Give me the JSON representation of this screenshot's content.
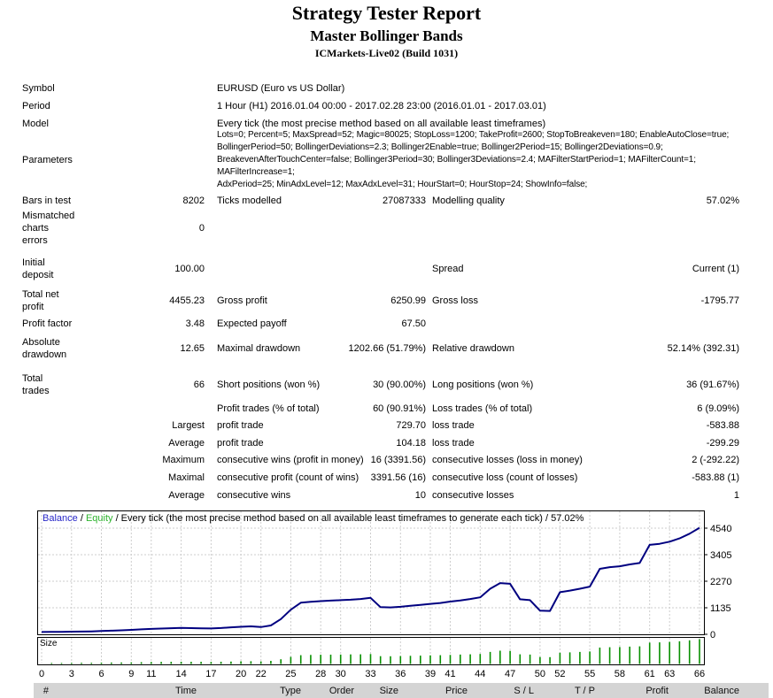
{
  "page": {
    "title": "Strategy Tester Report",
    "subtitle": "Master Bollinger Bands",
    "server": "ICMarkets-Live02 (Build 1031)"
  },
  "summary_rows": [
    {
      "c1": "Symbol",
      "c3": "EURUSD (Euro vs US Dollar)"
    },
    {
      "c1": "Period",
      "c3": "1 Hour (H1) 2016.01.04 00:00 - 2017.02.28 23:00 (2016.01.01 - 2017.03.01)"
    },
    {
      "c1": "Model",
      "c3": "Every tick (the most precise method based on all available least timeframes)"
    },
    {
      "c1": "Parameters",
      "c3": "Lots=0; Percent=5; MaxSpread=52; Magic=80025; StopLoss=1200; TakeProfit=2600; StopToBreakeven=180; EnableAutoClose=true;\nBollingerPeriod=50; BollingerDeviations=2.3; Bollinger2Enable=true; Bollinger2Period=15; Bollinger2Deviations=0.9;\nBreakevenAfterTouchCenter=false; Bollinger3Period=30; Bollinger3Deviations=2.4; MAFilterStartPeriod=1; MAFilterCount=1; MAFilterIncrease=1;\nAdxPeriod=25; MinAdxLevel=12; MaxAdxLevel=31; HourStart=0; HourStop=24; ShowInfo=false;",
      "params_style": true
    },
    {
      "c1": "Bars in test",
      "c2": "8202",
      "c3": "Ticks modelled",
      "c4": "27087333",
      "c5": "Modelling quality",
      "c6": "57.02%"
    },
    {
      "c1": "Mismatched\ncharts\nerrors",
      "c2": "0"
    },
    {
      "c1": "Initial\ndeposit",
      "c2": "100.00",
      "c5": "Spread",
      "c6": "Current (1)"
    },
    {
      "c1": "Total net\nprofit",
      "c2": "4455.23",
      "c3": "Gross profit",
      "c4": "6250.99",
      "c5": "Gross loss",
      "c6": "-1795.77"
    },
    {
      "c1": "Profit factor",
      "c2": "3.48",
      "c3": "Expected payoff",
      "c4": "67.50"
    },
    {
      "c1": "Absolute\ndrawdown",
      "c2": "12.65",
      "c3": "Maximal drawdown",
      "c4": "1202.66 (51.79%)",
      "c5": "Relative drawdown",
      "c6": "52.14% (392.31)"
    },
    {
      "c1": "Total\ntrades",
      "c2": "66",
      "c3": "Short positions (won %)",
      "c4": "30 (90.00%)",
      "c5": "Long positions (won %)",
      "c6": "36 (91.67%)"
    },
    {
      "c3": "Profit trades (% of total)",
      "c4": "60 (90.91%)",
      "c5": "Loss trades (% of total)",
      "c6": "6 (9.09%)"
    },
    {
      "c2": "Largest",
      "c3": "profit trade",
      "c4": "729.70",
      "c5": "loss trade",
      "c6": "-583.88"
    },
    {
      "c2": "Average",
      "c3": "profit trade",
      "c4": "104.18",
      "c5": "loss trade",
      "c6": "-299.29"
    },
    {
      "c2": "Maximum",
      "c3": "consecutive wins (profit in money)",
      "c4": "16 (3391.56)",
      "c5": "consecutive losses (loss in money)",
      "c6": "2 (-292.22)"
    },
    {
      "c2": "Maximal",
      "c3": "consecutive profit (count of wins)",
      "c4": "3391.56 (16)",
      "c5": "consecutive loss (count of losses)",
      "c6": "-583.88 (1)"
    },
    {
      "c2": "Average",
      "c3": "consecutive wins",
      "c4": "10",
      "c5": "consecutive losses",
      "c6": "1"
    }
  ],
  "chart_data": {
    "type": "line",
    "legend": [
      {
        "text": "Balance",
        "color": "#2828c8"
      },
      {
        "text": " / ",
        "color": "#000000"
      },
      {
        "text": "Equity",
        "color": "#2db32d"
      },
      {
        "text": " / Every tick (the most precise method based on all available least timeframes to generate each tick) / 57.02%",
        "color": "#000000"
      }
    ],
    "x_ticks": [
      0,
      3,
      6,
      9,
      11,
      14,
      17,
      20,
      22,
      25,
      28,
      30,
      33,
      36,
      39,
      41,
      44,
      47,
      50,
      52,
      55,
      58,
      61,
      63,
      66
    ],
    "y_ticks": [
      0,
      1135,
      2270,
      3405,
      4540
    ],
    "xlim": [
      0,
      66
    ],
    "ylim": [
      0,
      5295
    ],
    "grid": "dashed",
    "series": [
      {
        "name": "Balance",
        "color": "#000080",
        "values": [
          100,
          103,
          107,
          112,
          118,
          126,
          140,
          155,
          172,
          190,
          212,
          232,
          245,
          260,
          275,
          265,
          252,
          248,
          268,
          300,
          320,
          340,
          310,
          380,
          650,
          1050,
          1350,
          1390,
          1420,
          1440,
          1460,
          1480,
          1510,
          1560,
          1160,
          1150,
          1175,
          1220,
          1260,
          1300,
          1340,
          1400,
          1450,
          1510,
          1580,
          1950,
          2190,
          2160,
          1500,
          1460,
          1010,
          1000,
          1800,
          1870,
          1950,
          2040,
          2800,
          2870,
          2910,
          2990,
          3050,
          3825,
          3870,
          3960,
          4100,
          4300,
          4555
        ]
      }
    ],
    "size_panel": {
      "label": "Size",
      "bar_color": "#089000",
      "values": [
        0.04,
        0.041,
        0.043,
        0.045,
        0.047,
        0.052,
        0.056,
        0.061,
        0.066,
        0.073,
        0.078,
        0.082,
        0.086,
        0.09,
        0.087,
        0.084,
        0.083,
        0.088,
        0.097,
        0.107,
        0.112,
        0.105,
        0.124,
        0.19,
        0.287,
        0.355,
        0.364,
        0.371,
        0.375,
        0.38,
        0.384,
        0.39,
        0.401,
        0.313,
        0.311,
        0.317,
        0.327,
        0.336,
        0.345,
        0.354,
        0.366,
        0.377,
        0.39,
        0.405,
        0.486,
        0.536,
        0.53,
        0.388,
        0.38,
        0.278,
        0.276,
        0.454,
        0.469,
        0.486,
        0.505,
        0.661,
        0.675,
        0.683,
        0.699,
        0.711,
        0.862,
        0.871,
        0.888,
        0.915,
        0.953,
        1.0
      ]
    },
    "colors": {
      "grid": "#cdcdcd",
      "border": "#000000",
      "plot_bg": "#ffffff"
    }
  },
  "trades_table": {
    "columns": [
      "#",
      "Time",
      "Type",
      "Order",
      "Size",
      "Price",
      "S / L",
      "T / P",
      "Profit",
      "Balance"
    ],
    "header_bg": "#d4d4d4"
  }
}
